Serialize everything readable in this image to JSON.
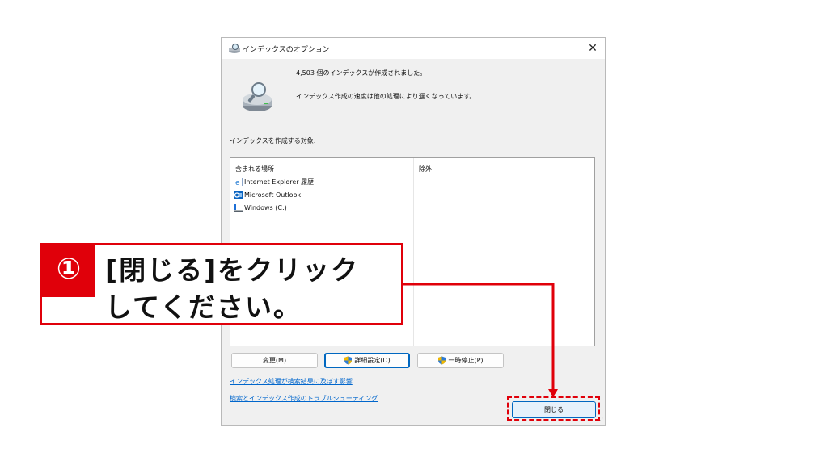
{
  "dialog": {
    "title": "インデックスのオプション",
    "close_glyph": "✕",
    "status_count": "4,503 個のインデックスが作成されました。",
    "status_speed": "インデックス作成の速度は他の処理により遅くなっています。",
    "section_label": "インデックスを作成する対象:",
    "columns": {
      "included": "含まれる場所",
      "excluded": "除外"
    },
    "locations": [
      {
        "label": "Internet Explorer 履歴",
        "icon": "internet-explorer-icon"
      },
      {
        "label": "Microsoft Outlook",
        "icon": "outlook-icon"
      },
      {
        "label": "Windows (C:)",
        "icon": "drive-icon"
      }
    ],
    "buttons": {
      "modify": "変更(M)",
      "advanced": "詳細設定(D)",
      "pause": "一時停止(P)",
      "close": "閉じる"
    },
    "links": {
      "effect": "インデックス処理が検索結果に及ぼす影響",
      "troubleshoot": "検索とインデックス作成のトラブルシューティング"
    }
  },
  "callout": {
    "number": "①",
    "line1": "[閉じる]をクリック",
    "line2": "してください。"
  },
  "colors": {
    "accent_red": "#e0000a",
    "link_blue": "#0066cc",
    "focus_blue": "#0067c0"
  }
}
